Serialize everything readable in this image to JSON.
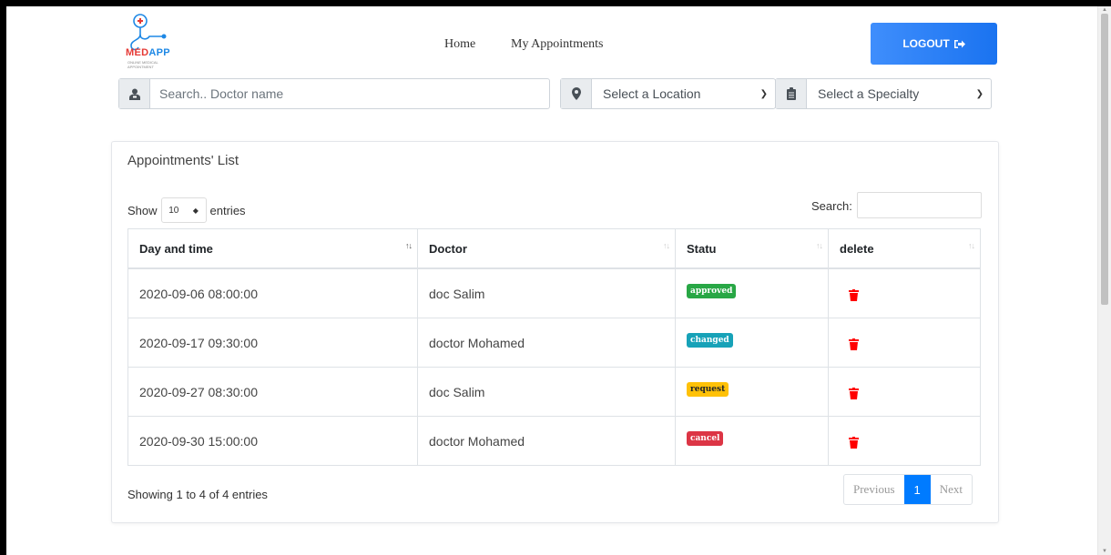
{
  "logo": {
    "brand_part1": "MED",
    "brand_part2": "APP",
    "tagline": "ONLINE MEDICAL APPOINTMENT"
  },
  "nav": {
    "home": "Home",
    "my_appointments": "My Appointments"
  },
  "logout": {
    "label": "LOGOUT",
    "icon": "sign-out-icon"
  },
  "search": {
    "doctor_placeholder": "Search.. Doctor name",
    "location_selected": "Select a Location",
    "specialty_selected": "Select a Specialty"
  },
  "card": {
    "title": "Appointments' List",
    "show_label": "Show",
    "entries_label": "entries",
    "page_length": "10",
    "search_label": "Search:",
    "columns": [
      "Day and time",
      "Doctor",
      "Statu",
      "delete"
    ],
    "rows": [
      {
        "datetime": "2020-09-06 08:00:00",
        "doctor": "doc Salim",
        "status": "approved",
        "status_color": "#28a745"
      },
      {
        "datetime": "2020-09-17 09:30:00",
        "doctor": "doctor Mohamed",
        "status": "changed",
        "status_color": "#17a2b8"
      },
      {
        "datetime": "2020-09-27 08:30:00",
        "doctor": "doc Salim",
        "status": "request",
        "status_color": "#ffc107"
      },
      {
        "datetime": "2020-09-30 15:00:00",
        "doctor": "doctor Mohamed",
        "status": "cancel",
        "status_color": "#dc3545"
      }
    ],
    "info": "Showing 1 to 4 of 4 entries",
    "pager": {
      "previous": "Previous",
      "current": "1",
      "next": "Next"
    }
  },
  "colors": {
    "primary": "#007bff",
    "trash": "#ff0000"
  }
}
